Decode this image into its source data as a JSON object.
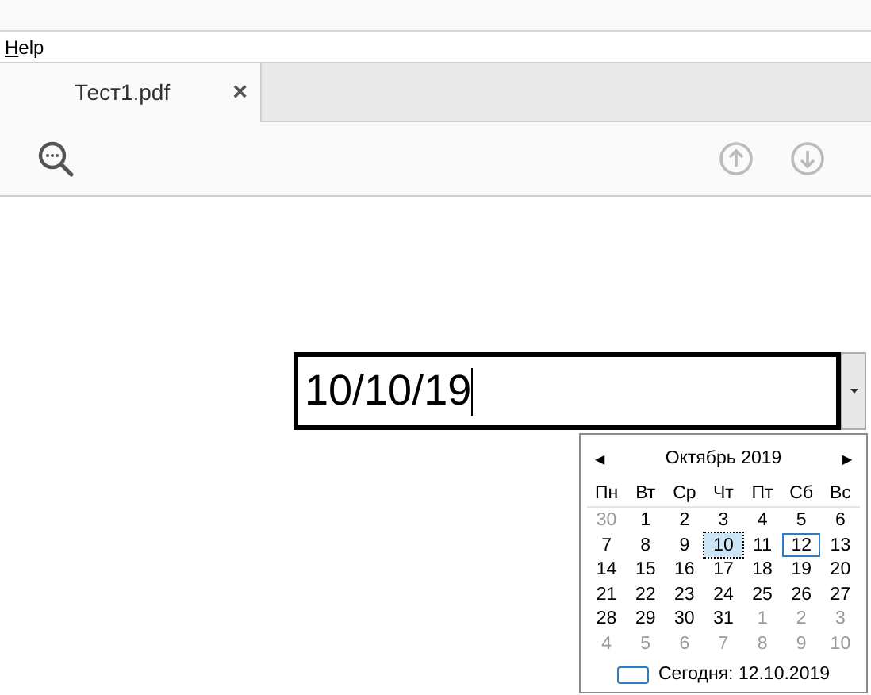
{
  "menu": [
    {
      "label": "Help"
    }
  ],
  "tabs": [
    {
      "label": "Тест1.pdf",
      "close": "×",
      "selected": true
    }
  ],
  "date_field": {
    "value": "10/10/19"
  },
  "calendar": {
    "prev": "◀",
    "next": "▶",
    "title": "Октябрь 2019",
    "weekdays": [
      "Пн",
      "Вт",
      "Ср",
      "Чт",
      "Пт",
      "Сб",
      "Вс"
    ],
    "weeks": [
      [
        {
          "day": "30",
          "other_month": true,
          "selected": false,
          "today": false
        },
        {
          "day": "1",
          "other_month": false,
          "selected": false,
          "today": false
        },
        {
          "day": "2",
          "other_month": false,
          "selected": false,
          "today": false
        },
        {
          "day": "3",
          "other_month": false,
          "selected": false,
          "today": false
        },
        {
          "day": "4",
          "other_month": false,
          "selected": false,
          "today": false
        },
        {
          "day": "5",
          "other_month": false,
          "selected": false,
          "today": false
        },
        {
          "day": "6",
          "other_month": false,
          "selected": false,
          "today": false
        }
      ],
      [
        {
          "day": "7",
          "other_month": false,
          "selected": false,
          "today": false
        },
        {
          "day": "8",
          "other_month": false,
          "selected": false,
          "today": false
        },
        {
          "day": "9",
          "other_month": false,
          "selected": false,
          "today": false
        },
        {
          "day": "10",
          "other_month": false,
          "selected": true,
          "today": false
        },
        {
          "day": "11",
          "other_month": false,
          "selected": false,
          "today": false
        },
        {
          "day": "12",
          "other_month": false,
          "selected": false,
          "today": true
        },
        {
          "day": "13",
          "other_month": false,
          "selected": false,
          "today": false
        }
      ],
      [
        {
          "day": "14",
          "other_month": false,
          "selected": false,
          "today": false
        },
        {
          "day": "15",
          "other_month": false,
          "selected": false,
          "today": false
        },
        {
          "day": "16",
          "other_month": false,
          "selected": false,
          "today": false
        },
        {
          "day": "17",
          "other_month": false,
          "selected": false,
          "today": false
        },
        {
          "day": "18",
          "other_month": false,
          "selected": false,
          "today": false
        },
        {
          "day": "19",
          "other_month": false,
          "selected": false,
          "today": false
        },
        {
          "day": "20",
          "other_month": false,
          "selected": false,
          "today": false
        }
      ],
      [
        {
          "day": "21",
          "other_month": false,
          "selected": false,
          "today": false
        },
        {
          "day": "22",
          "other_month": false,
          "selected": false,
          "today": false
        },
        {
          "day": "23",
          "other_month": false,
          "selected": false,
          "today": false
        },
        {
          "day": "24",
          "other_month": false,
          "selected": false,
          "today": false
        },
        {
          "day": "25",
          "other_month": false,
          "selected": false,
          "today": false
        },
        {
          "day": "26",
          "other_month": false,
          "selected": false,
          "today": false
        },
        {
          "day": "27",
          "other_month": false,
          "selected": false,
          "today": false
        }
      ],
      [
        {
          "day": "28",
          "other_month": false,
          "selected": false,
          "today": false
        },
        {
          "day": "29",
          "other_month": false,
          "selected": false,
          "today": false
        },
        {
          "day": "30",
          "other_month": false,
          "selected": false,
          "today": false
        },
        {
          "day": "31",
          "other_month": false,
          "selected": false,
          "today": false
        },
        {
          "day": "1",
          "other_month": true,
          "selected": false,
          "today": false
        },
        {
          "day": "2",
          "other_month": true,
          "selected": false,
          "today": false
        },
        {
          "day": "3",
          "other_month": true,
          "selected": false,
          "today": false
        }
      ],
      [
        {
          "day": "4",
          "other_month": true,
          "selected": false,
          "today": false
        },
        {
          "day": "5",
          "other_month": true,
          "selected": false,
          "today": false
        },
        {
          "day": "6",
          "other_month": true,
          "selected": false,
          "today": false
        },
        {
          "day": "7",
          "other_month": true,
          "selected": false,
          "today": false
        },
        {
          "day": "8",
          "other_month": true,
          "selected": false,
          "today": false
        },
        {
          "day": "9",
          "other_month": true,
          "selected": false,
          "today": false
        },
        {
          "day": "10",
          "other_month": true,
          "selected": false,
          "today": false
        }
      ]
    ],
    "today_label": "Сегодня: 12.10.2019"
  }
}
